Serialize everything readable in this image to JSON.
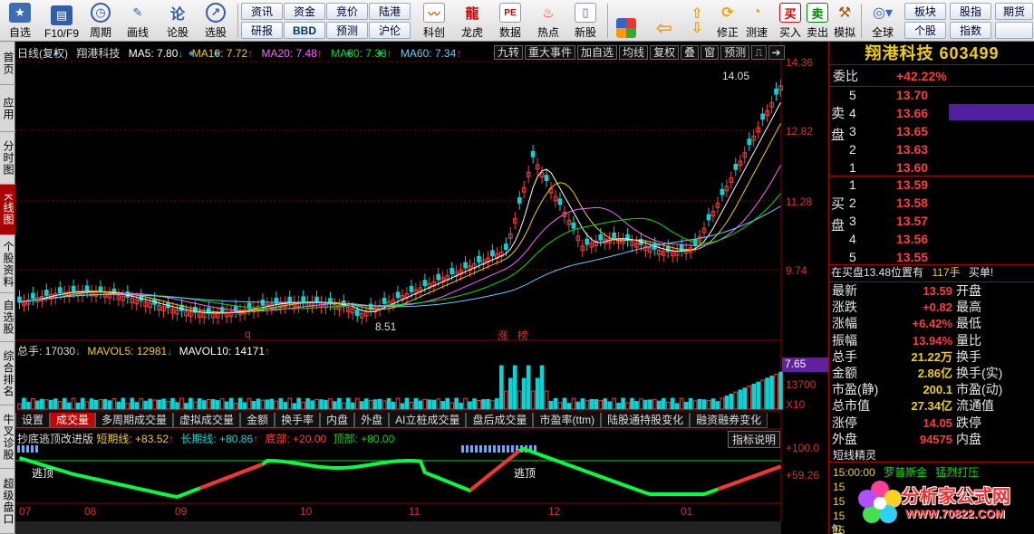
{
  "toolbar": {
    "buttons": [
      {
        "label": "自选"
      },
      {
        "label": "F10/F9"
      },
      {
        "label": "周期"
      },
      {
        "label": "画线"
      },
      {
        "label": "论股"
      },
      {
        "label": "选股"
      }
    ],
    "pairs": [
      {
        "top": "资讯",
        "bottom": "研报"
      },
      {
        "top": "资金",
        "bottom": "BBD"
      },
      {
        "top": "竞价",
        "bottom": "预测"
      },
      {
        "top": "陆港",
        "bottom": "沪伦"
      }
    ],
    "buttons2": [
      {
        "label": "科创"
      },
      {
        "label": "龙虎"
      },
      {
        "label": "数据"
      },
      {
        "label": "热点"
      },
      {
        "label": "新股"
      }
    ],
    "buttons3": [
      {
        "label": "修正"
      },
      {
        "label": "测速"
      },
      {
        "label": "买入"
      },
      {
        "label": "卖出"
      },
      {
        "label": "模拟"
      },
      {
        "label": "全球"
      }
    ],
    "pairs2": [
      {
        "top": "板块",
        "bottom": "个股"
      },
      {
        "top": "股指",
        "bottom": "指数"
      },
      {
        "top": "期货",
        "bottom": ""
      }
    ]
  },
  "left_tabs": [
    "首页",
    "应用",
    "分时图",
    "K线图",
    "个股资料",
    "自选股",
    "综合排名",
    "牛叉诊股",
    "超级盘口"
  ],
  "kline": {
    "title": "日线(复权)",
    "stock": "翔港科技",
    "ma": [
      {
        "label": "MA5: 7.80",
        "arrow": "↓",
        "color": "#ffffff"
      },
      {
        "label": "MA10: 7.72",
        "arrow": "↑",
        "color": "#f0d000"
      },
      {
        "label": "MA20: 7.48",
        "arrow": "↑",
        "color": "#ff66ff"
      },
      {
        "label": "MA30: 7.38",
        "arrow": "↑",
        "color": "#00e000"
      },
      {
        "label": "MA60: 7.34",
        "arrow": "↑",
        "color": "#66ccff"
      }
    ],
    "buttons": [
      "九转",
      "重大事件",
      "加自选",
      "均线",
      "复权",
      "叠",
      "窗",
      "预测"
    ],
    "price_axis": [
      "14.36",
      "12.82",
      "11.28",
      "9.74"
    ],
    "high_label": "14.05",
    "low_label": "8.51",
    "marker_q": "q",
    "marker_zhang": "涨",
    "marker_bang": "榜"
  },
  "volume": {
    "total": "总手: 17030",
    "mavol5": "MAVOL5: 12981",
    "mavol10": "MAVOL10: 14171",
    "axis": [
      "13700",
      "X10"
    ],
    "badge": "7.65"
  },
  "subtabs": [
    "设置",
    "成交量",
    "多周期成交量",
    "虚拟成交量",
    "金额",
    "换手率",
    "内盘",
    "外盘",
    "AI立桩成交量",
    "盘后成交量",
    "市盈率(ttm)",
    "陆股通持股变化",
    "融资融券变化"
  ],
  "indicator": {
    "name": "抄底逃顶改进版",
    "short": "短期线: +83.52",
    "long": "长期线: +80.86",
    "bottom": "底部: +20.00",
    "top": "顶部: +80.00",
    "button": "指标说明",
    "axis": [
      "+100.0",
      "+59.26"
    ],
    "escape1": "逃顶",
    "escape2": "逃顶"
  },
  "months": [
    "07",
    "08",
    "09",
    "10",
    "11",
    "12",
    "01"
  ],
  "quote": {
    "title": "翔港科技 603499",
    "weibi_label": "委比",
    "weibi_value": "+42.22%",
    "sell_label": "卖盘",
    "buy_label": "买盘",
    "sell": [
      {
        "n": "5",
        "price": "13.70"
      },
      {
        "n": "4",
        "price": "13.66"
      },
      {
        "n": "3",
        "price": "13.65"
      },
      {
        "n": "2",
        "price": "13.63"
      },
      {
        "n": "1",
        "price": "13.60"
      }
    ],
    "buy": [
      {
        "n": "1",
        "price": "13.59"
      },
      {
        "n": "2",
        "price": "13.58"
      },
      {
        "n": "3",
        "price": "13.57"
      },
      {
        "n": "4",
        "price": "13.56"
      },
      {
        "n": "5",
        "price": "13.55"
      }
    ],
    "note": "在买盘13.48位置有",
    "note_qty": "117手",
    "note_tag": "买单!",
    "stats": [
      {
        "l": "最新",
        "v": "13.59",
        "l2": "开盘"
      },
      {
        "l": "涨跌",
        "v": "+0.82",
        "l2": "最高"
      },
      {
        "l": "涨幅",
        "v": "+6.42%",
        "l2": "最低"
      },
      {
        "l": "振幅",
        "v": "13.94%",
        "l2": "量比"
      },
      {
        "l": "总手",
        "v": "21.22万",
        "l2": "换手"
      },
      {
        "l": "金额",
        "v": "2.86亿",
        "l2": "换手(实)"
      },
      {
        "l": "市盈(静)",
        "v": "200.1",
        "l2": "市盈(动)"
      },
      {
        "l": "总市值",
        "v": "27.34亿",
        "l2": "流通值"
      },
      {
        "l": "涨停",
        "v": "14.05",
        "l2": "跌停"
      },
      {
        "l": "外盘",
        "v": "94575",
        "l2": "内盘"
      }
    ],
    "jingling_title": "短线精灵",
    "jingling": [
      {
        "time": "15:00:00",
        "name": "罗普斯金",
        "event": "猛烈打压"
      }
    ],
    "jingling_rows": [
      "15",
      "15",
      "15",
      "15",
      "包"
    ]
  },
  "watermark": {
    "name": "分析家公式网",
    "url": "WWW.70822.COM"
  },
  "colors": {
    "up": "#ff3b3b",
    "down": "#00d8d8",
    "grid": "#8b0000",
    "accent": "#f0d000"
  }
}
